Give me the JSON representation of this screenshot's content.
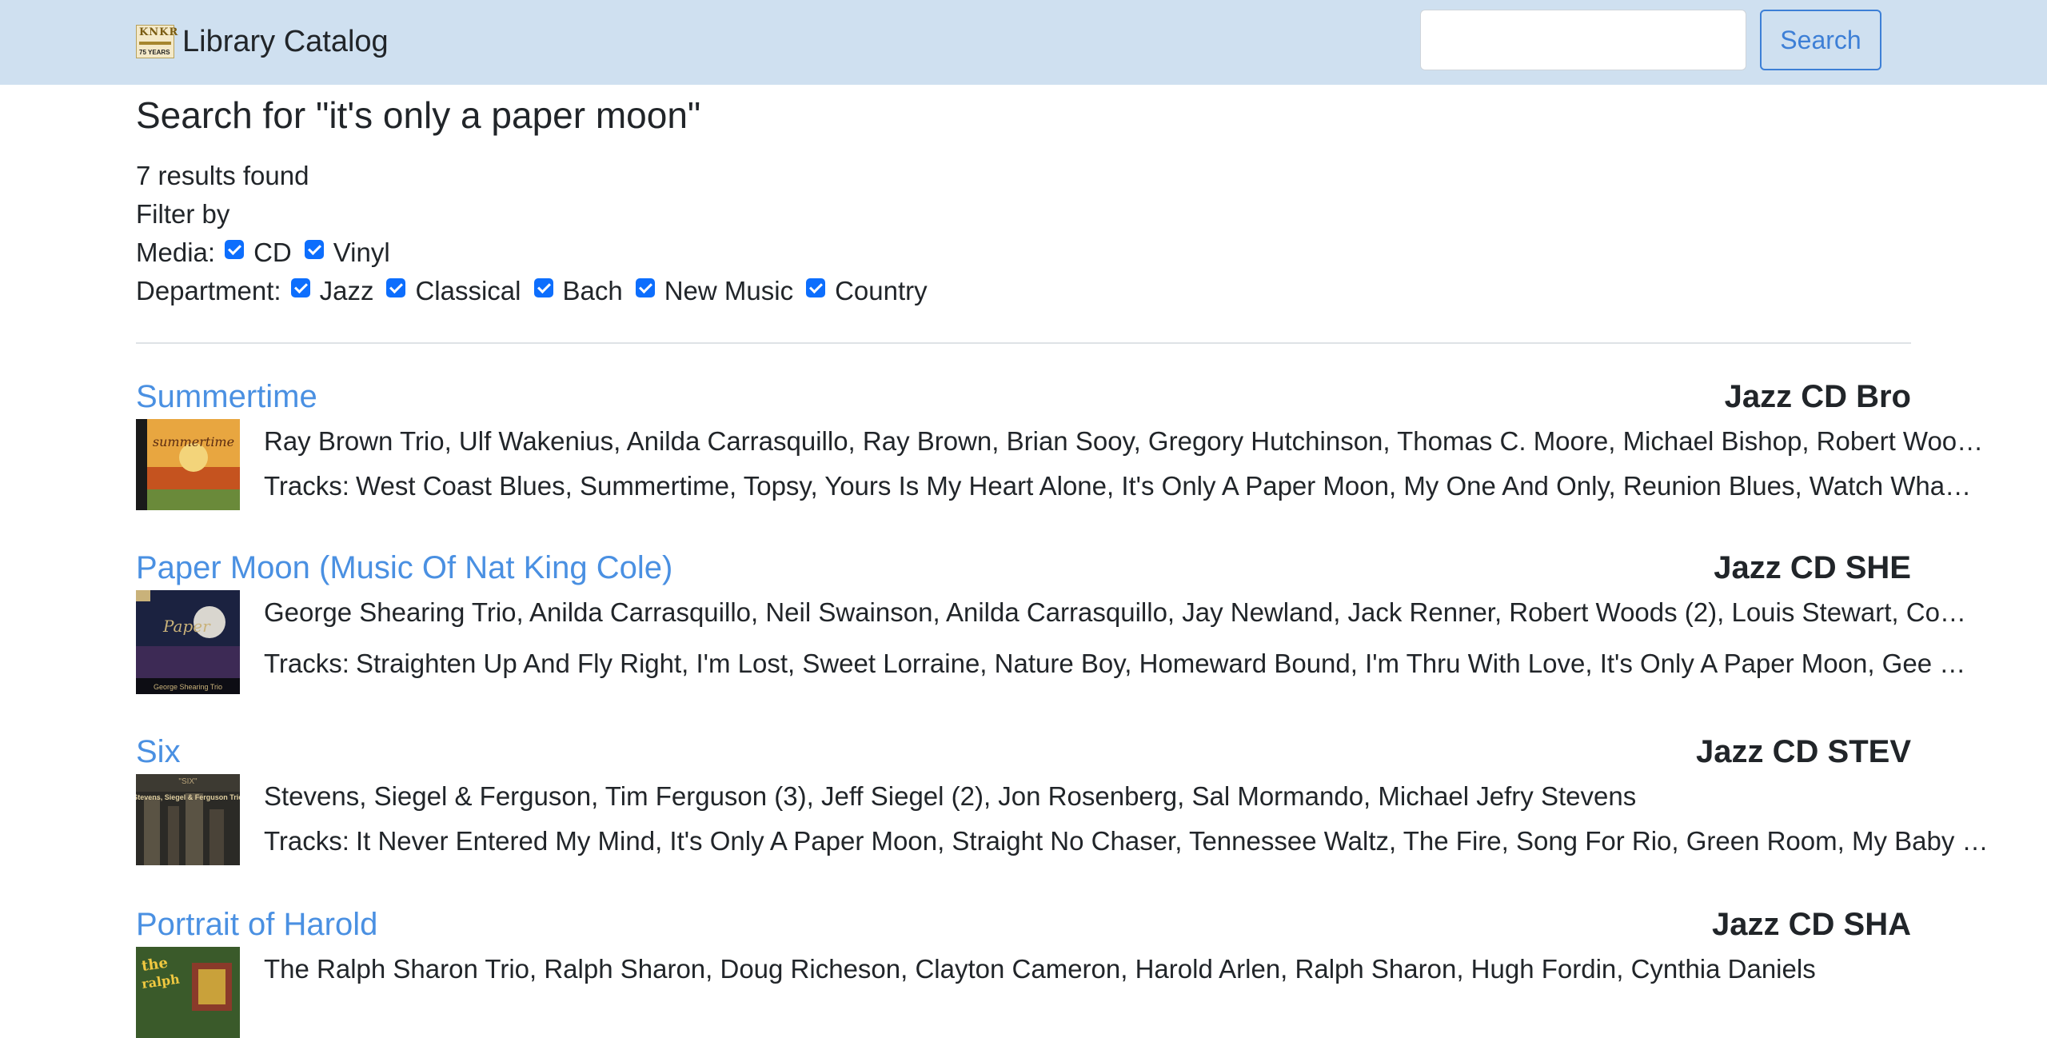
{
  "header": {
    "logo_text_top": "KNKR",
    "logo_text_bottom": "75 YEARS",
    "brand": "Library Catalog",
    "search_placeholder": "",
    "search_button": "Search"
  },
  "page": {
    "heading": "Search for \"it's only a paper moon\"",
    "results_count": "7 results found",
    "filter_label": "Filter by",
    "media_label": "Media:",
    "media_options": [
      "CD",
      "Vinyl"
    ],
    "department_label": "Department:",
    "department_options": [
      "Jazz",
      "Classical",
      "Bach",
      "New Music",
      "Country"
    ]
  },
  "tracks_prefix": "Tracks:",
  "results": [
    {
      "title": "Summertime",
      "call_number": "Jazz CD Bro",
      "artists": "Ray Brown Trio, Ulf Wakenius, Anilda Carrasquillo, Ray Brown, Brian Sooy, Gregory Hutchinson, Thomas C. Moore, Michael Bishop, Robert Woo…",
      "tracks": "West Coast Blues, Summertime, Topsy, Yours Is My Heart Alone, It's Only A Paper Moon, My One And Only, Reunion Blues, Watch Wha…",
      "cover_colors": [
        "#e8a640",
        "#c5531f",
        "#6a8a3a"
      ]
    },
    {
      "title": "Paper Moon (Music Of Nat King Cole)",
      "call_number": "Jazz CD SHE",
      "artists": "George Shearing Trio, Anilda Carrasquillo, Neil Swainson, Anilda Carrasquillo, Jay Newland, Jack Renner, Robert Woods (2), Louis Stewart, Co…",
      "tracks": "Straighten Up And Fly Right, I'm Lost, Sweet Lorraine, Nature Boy, Homeward Bound, I'm Thru With Love, It's Only A Paper Moon, Gee …",
      "cover_colors": [
        "#1b2240",
        "#3d2a55",
        "#c9b27a"
      ]
    },
    {
      "title": "Six",
      "call_number": "Jazz CD STEV",
      "artists": "Stevens, Siegel & Ferguson, Tim Ferguson (3), Jeff Siegel (2), Jon Rosenberg, Sal Mormando, Michael Jefry Stevens",
      "tracks": "It Never Entered My Mind, It's Only A Paper Moon, Straight No Chaser, Tennessee Waltz, The Fire, Song For Rio, Green Room, My Baby …",
      "cover_colors": [
        "#2b2a26",
        "#5a5344",
        "#b8a37a"
      ]
    },
    {
      "title": "Portrait of Harold",
      "call_number": "Jazz CD SHA",
      "artists": "The Ralph Sharon Trio, Ralph Sharon, Doug Richeson, Clayton Cameron, Harold Arlen, Ralph Sharon, Hugh Fordin, Cynthia Daniels",
      "tracks": "",
      "cover_colors": [
        "#3a5a2a",
        "#c9a13a",
        "#8a3a2a"
      ]
    }
  ]
}
